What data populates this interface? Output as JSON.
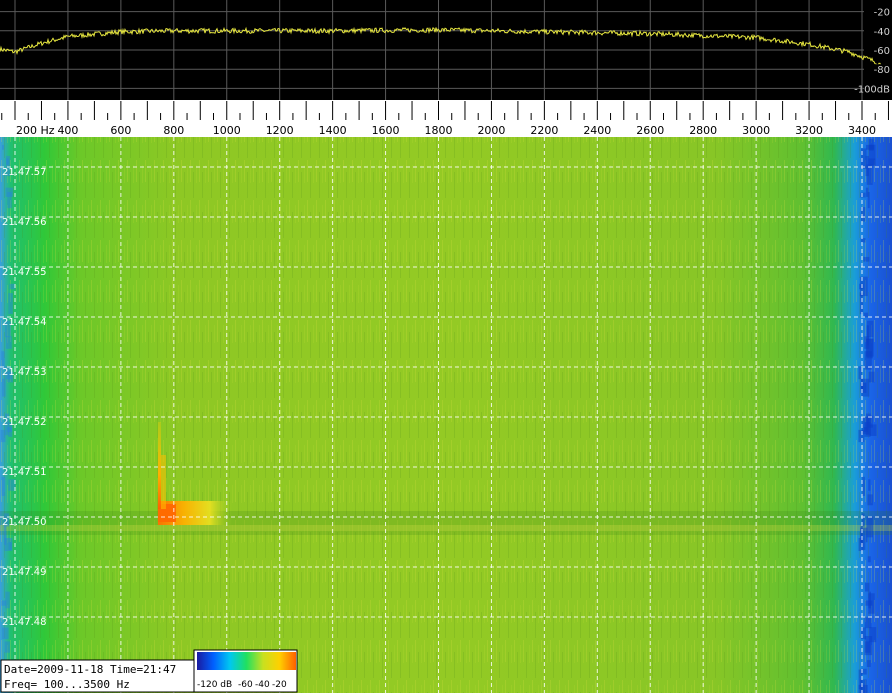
{
  "chart_data": {
    "type": "heatmap",
    "title": "",
    "x_unit": "Hz",
    "x_range": [
      100,
      3500
    ],
    "x_ticks": [
      200,
      400,
      600,
      800,
      1000,
      1200,
      1400,
      1600,
      1800,
      2000,
      2200,
      2400,
      2600,
      2800,
      3000,
      3200,
      3400
    ],
    "x_tick_labels": [
      "200 Hz",
      "400",
      "600",
      "800",
      "1000",
      "1200",
      "1400",
      "1600",
      "1800",
      "2000",
      "2200",
      "2400",
      "2600",
      "2800",
      "3000",
      "3200",
      "3400"
    ],
    "spectrum": {
      "y_ticks": [
        -20,
        -40,
        -60,
        -80,
        -100
      ],
      "y_tick_labels": [
        "-20",
        "-40",
        "-60",
        "-80",
        "-100dB"
      ],
      "ylim": [
        -110,
        -10
      ],
      "line_color": "#e8e840",
      "profile": [
        {
          "hz": 100,
          "db": -57
        },
        {
          "hz": 200,
          "db": -62
        },
        {
          "hz": 300,
          "db": -53
        },
        {
          "hz": 400,
          "db": -46
        },
        {
          "hz": 600,
          "db": -41
        },
        {
          "hz": 800,
          "db": -40
        },
        {
          "hz": 1000,
          "db": -40
        },
        {
          "hz": 1400,
          "db": -40
        },
        {
          "hz": 1800,
          "db": -39
        },
        {
          "hz": 2200,
          "db": -41
        },
        {
          "hz": 2600,
          "db": -43
        },
        {
          "hz": 3000,
          "db": -47
        },
        {
          "hz": 3200,
          "db": -54
        },
        {
          "hz": 3350,
          "db": -62
        },
        {
          "hz": 3450,
          "db": -72
        },
        {
          "hz": 3500,
          "db": -80
        }
      ]
    },
    "waterfall": {
      "time_labels": [
        "21.47.57",
        "21.47.56",
        "21.47.55",
        "21.47.54",
        "21.47.53",
        "21.47.52",
        "21.47.51",
        "21.47.50",
        "21.47.49",
        "21.47.48"
      ],
      "event": {
        "hz_start": 740,
        "hz_end": 1020,
        "time": "21.47.50",
        "peak_db": -20
      }
    },
    "colorbar": {
      "labels": [
        "-120 dB",
        "-60",
        "-40",
        "-20"
      ],
      "stops": [
        "#1a1aa0",
        "#0060ff",
        "#00c8f0",
        "#20e060",
        "#c8e020",
        "#ffd000",
        "#ff6000"
      ]
    },
    "grid": true
  },
  "info": {
    "date_line": "Date=2009-11-18 Time=21:47",
    "freq_line": "Freq= 100...3500 Hz"
  }
}
